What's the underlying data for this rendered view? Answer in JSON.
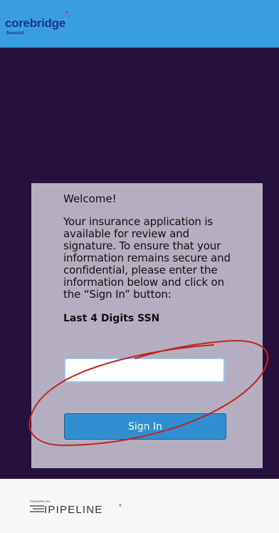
{
  "header": {
    "logo_text": "corebridge",
    "logo_subtext": "financial"
  },
  "card": {
    "welcome": "Welcome!",
    "intro": "Your insurance application is available for review and signature. To ensure that your information remains secure and confidential, please enter the information below and click on the “Sign In” button:",
    "ssn_label": "Last 4 Digits SSN",
    "ssn_value": "",
    "sign_in_label": "Sign In"
  },
  "footer": {
    "powered_by": "POWERED BY",
    "brand": "IPIPELINE",
    "trademark": "®"
  },
  "colors": {
    "header_bg": "#3a9fe0",
    "stage_bg": "#26103c",
    "card_bg": "#b5aec0",
    "button_bg": "#2f8fd0",
    "annotation": "#c0261e"
  }
}
